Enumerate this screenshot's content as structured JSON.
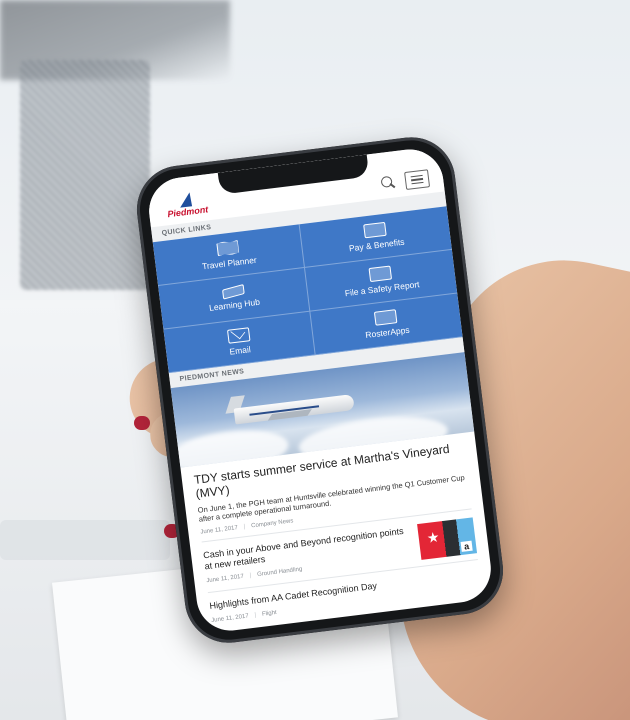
{
  "header": {
    "logo_text": "Piedmont"
  },
  "quick_links": {
    "label": "QUICK LINKS",
    "tiles": [
      {
        "label": "Travel Planner",
        "icon": "map-icon"
      },
      {
        "label": "Pay & Benefits",
        "icon": "money-icon"
      },
      {
        "label": "Learning Hub",
        "icon": "graduation-cap-icon"
      },
      {
        "label": "File a Safety Report",
        "icon": "safety-vest-icon"
      },
      {
        "label": "Email",
        "icon": "mail-icon"
      },
      {
        "label": "RosterApps",
        "icon": "calendar-clock-icon"
      }
    ]
  },
  "news": {
    "label": "PIEDMONT NEWS",
    "featured": {
      "title": "TDY starts summer service at Martha's Vineyard (MVY)",
      "summary": "On June 1, the PGH team at Huntsville celebrated winning the Q1 Customer Cup after a complete operational turnaround.",
      "date": "June 11, 2017",
      "category": "Company News"
    },
    "items": [
      {
        "title": "Cash in your Above and Beyond recognition points at new retailers",
        "date": "June 11, 2017",
        "category": "Ground Handling",
        "thumb_brand": "a"
      },
      {
        "title": "Highlights from AA Cadet Recognition Day",
        "date": "June 11, 2017",
        "category": "Flight"
      }
    ]
  },
  "colors": {
    "tile_blue": "#3f78c7",
    "brand_red": "#c8102e",
    "brand_blue": "#1f4e9c"
  }
}
